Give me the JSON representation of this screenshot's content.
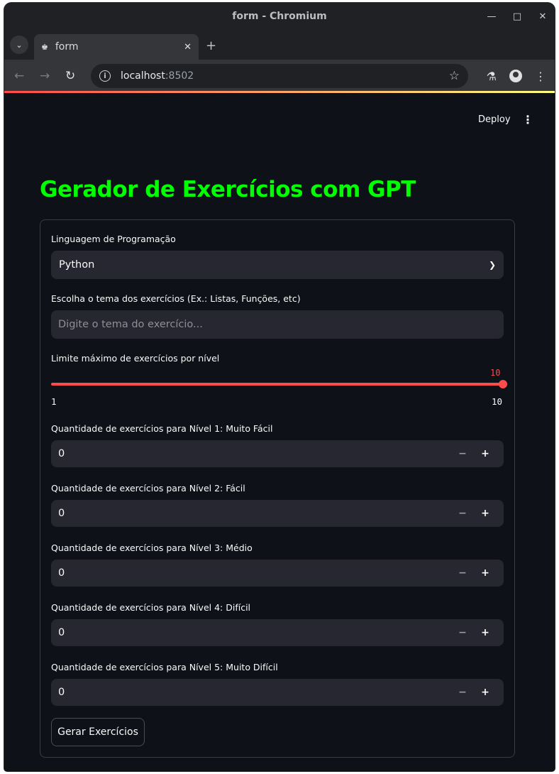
{
  "browser": {
    "window_title": "form - Chromium",
    "tab_title": "form",
    "url_host": "localhost",
    "url_port": ":8502"
  },
  "app": {
    "deploy_label": "Deploy",
    "title": "Gerador de Exercícios com GPT"
  },
  "form": {
    "language": {
      "label": "Linguagem de Programação",
      "selected": "Python"
    },
    "theme": {
      "label": "Escolha o tema dos exercícios (Ex.: Listas, Funções, etc)",
      "placeholder": "Digite o tema do exercício...",
      "value": ""
    },
    "slider": {
      "label": "Limite máximo de exercícios por nível",
      "value": "10",
      "min": "1",
      "max": "10"
    },
    "levels": [
      {
        "label": "Quantidade de exercícios para Nível 1: Muito Fácil",
        "value": "0"
      },
      {
        "label": "Quantidade de exercícios para Nível 2: Fácil",
        "value": "0"
      },
      {
        "label": "Quantidade de exercícios para Nível 3: Médio",
        "value": "0"
      },
      {
        "label": "Quantidade de exercícios para Nível 4: Difícil",
        "value": "0"
      },
      {
        "label": "Quantidade de exercícios para Nível 5: Muito Difícil",
        "value": "0"
      }
    ],
    "stepper_minus": "−",
    "stepper_plus": "+",
    "submit_label": "Gerar Exercícios"
  },
  "colors": {
    "title": "#00ff00",
    "accent": "#ff4b4b",
    "background": "#0e1117",
    "widget_bg": "#262730"
  },
  "icons": [
    "menu-icon",
    "crown-icon",
    "close-icon",
    "plus-icon",
    "back-icon",
    "forward-icon",
    "reload-icon",
    "info-icon",
    "star-icon",
    "flask-icon",
    "profile-icon",
    "kebab-icon",
    "chevron-down-icon"
  ]
}
